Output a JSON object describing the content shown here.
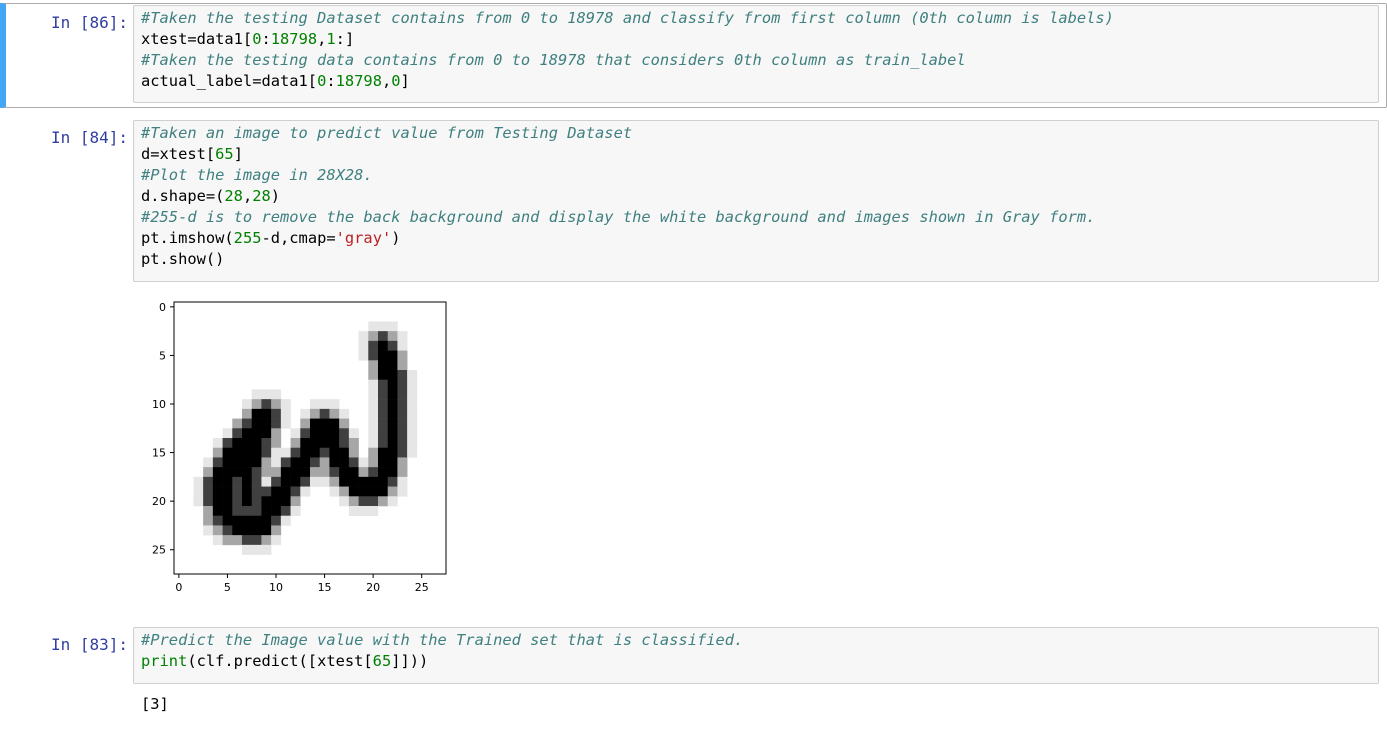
{
  "cells": [
    {
      "prompt": "In [86]:",
      "lines": [
        [
          {
            "t": "#Taken the testing Dataset contains from 0 to 18978 and classify from first column (0th column is labels)",
            "c": "cm"
          }
        ],
        [
          {
            "t": "xtest=data1[",
            "c": ""
          },
          {
            "t": "0",
            "c": "nm"
          },
          {
            "t": ":",
            "c": ""
          },
          {
            "t": "18798",
            "c": "nm"
          },
          {
            "t": ",",
            "c": ""
          },
          {
            "t": "1",
            "c": "nm"
          },
          {
            "t": ":]",
            "c": ""
          }
        ],
        [
          {
            "t": "#Taken the testing data contains from 0 to 18978 that considers 0th column as train_label",
            "c": "cm"
          }
        ],
        [
          {
            "t": "actual_label=data1[",
            "c": ""
          },
          {
            "t": "0",
            "c": "nm"
          },
          {
            "t": ":",
            "c": ""
          },
          {
            "t": "18798",
            "c": "nm"
          },
          {
            "t": ",",
            "c": ""
          },
          {
            "t": "0",
            "c": "nm"
          },
          {
            "t": "]",
            "c": ""
          }
        ]
      ]
    },
    {
      "prompt": "In [84]:",
      "lines": [
        [
          {
            "t": "#Taken an image to predict value from Testing Dataset",
            "c": "cm"
          }
        ],
        [
          {
            "t": "d=xtest[",
            "c": ""
          },
          {
            "t": "65",
            "c": "nm"
          },
          {
            "t": "]",
            "c": ""
          }
        ],
        [
          {
            "t": "#Plot the image in 28X28.",
            "c": "cm"
          }
        ],
        [
          {
            "t": "d.shape=(",
            "c": ""
          },
          {
            "t": "28",
            "c": "nm"
          },
          {
            "t": ",",
            "c": ""
          },
          {
            "t": "28",
            "c": "nm"
          },
          {
            "t": ")",
            "c": ""
          }
        ],
        [
          {
            "t": "#255-d is to remove the back background and display the white background and images shown in Gray form.",
            "c": "cm"
          }
        ],
        [
          {
            "t": "pt.imshow(",
            "c": ""
          },
          {
            "t": "255",
            "c": "nm"
          },
          {
            "t": "-d,cmap=",
            "c": ""
          },
          {
            "t": "'gray'",
            "c": "st"
          },
          {
            "t": ")",
            "c": ""
          }
        ],
        [
          {
            "t": "pt.show()",
            "c": ""
          }
        ]
      ]
    },
    {
      "prompt": "In [83]:",
      "lines": [
        [
          {
            "t": "#Predict the Image value with the Trained set that is classified.",
            "c": "cm"
          }
        ],
        [
          {
            "t": "print",
            "c": "bi"
          },
          {
            "t": "(clf.predict([xtest[",
            "c": ""
          },
          {
            "t": "65",
            "c": "nm"
          },
          {
            "t": "]]))",
            "c": ""
          }
        ]
      ],
      "output": "[3]"
    }
  ],
  "colors": {
    "prompt": "#303f9f",
    "comment": "#408080",
    "number": "#008000",
    "string": "#ba2121",
    "selected_bar": "#42a5f5"
  },
  "chart_data": {
    "type": "heatmap",
    "title": "",
    "xlabel": "",
    "ylabel": "",
    "colormap": "gray (inverted: 255-d)",
    "xlim": [
      0,
      27
    ],
    "ylim": [
      27,
      0
    ],
    "xticks": [
      "0",
      "5",
      "10",
      "15",
      "20",
      "25"
    ],
    "yticks": [
      "0",
      "5",
      "10",
      "15",
      "20",
      "25"
    ],
    "grid": false,
    "description_value": "handwritten digit image, 28x28",
    "strokes": [
      {
        "points": [
          [
            9,
            11
          ],
          [
            6,
            15
          ],
          [
            4,
            19
          ],
          [
            5,
            22
          ],
          [
            8,
            23
          ],
          [
            10,
            20
          ],
          [
            12,
            17
          ],
          [
            14,
            14
          ],
          [
            15,
            12
          ],
          [
            16,
            14
          ],
          [
            17,
            17
          ],
          [
            19,
            19
          ],
          [
            21,
            18
          ],
          [
            22,
            14
          ],
          [
            22,
            8
          ],
          [
            21,
            4
          ]
        ]
      },
      {
        "points": [
          [
            9,
            11
          ],
          [
            8,
            14
          ],
          [
            7,
            17
          ],
          [
            7,
            20
          ]
        ]
      }
    ]
  }
}
